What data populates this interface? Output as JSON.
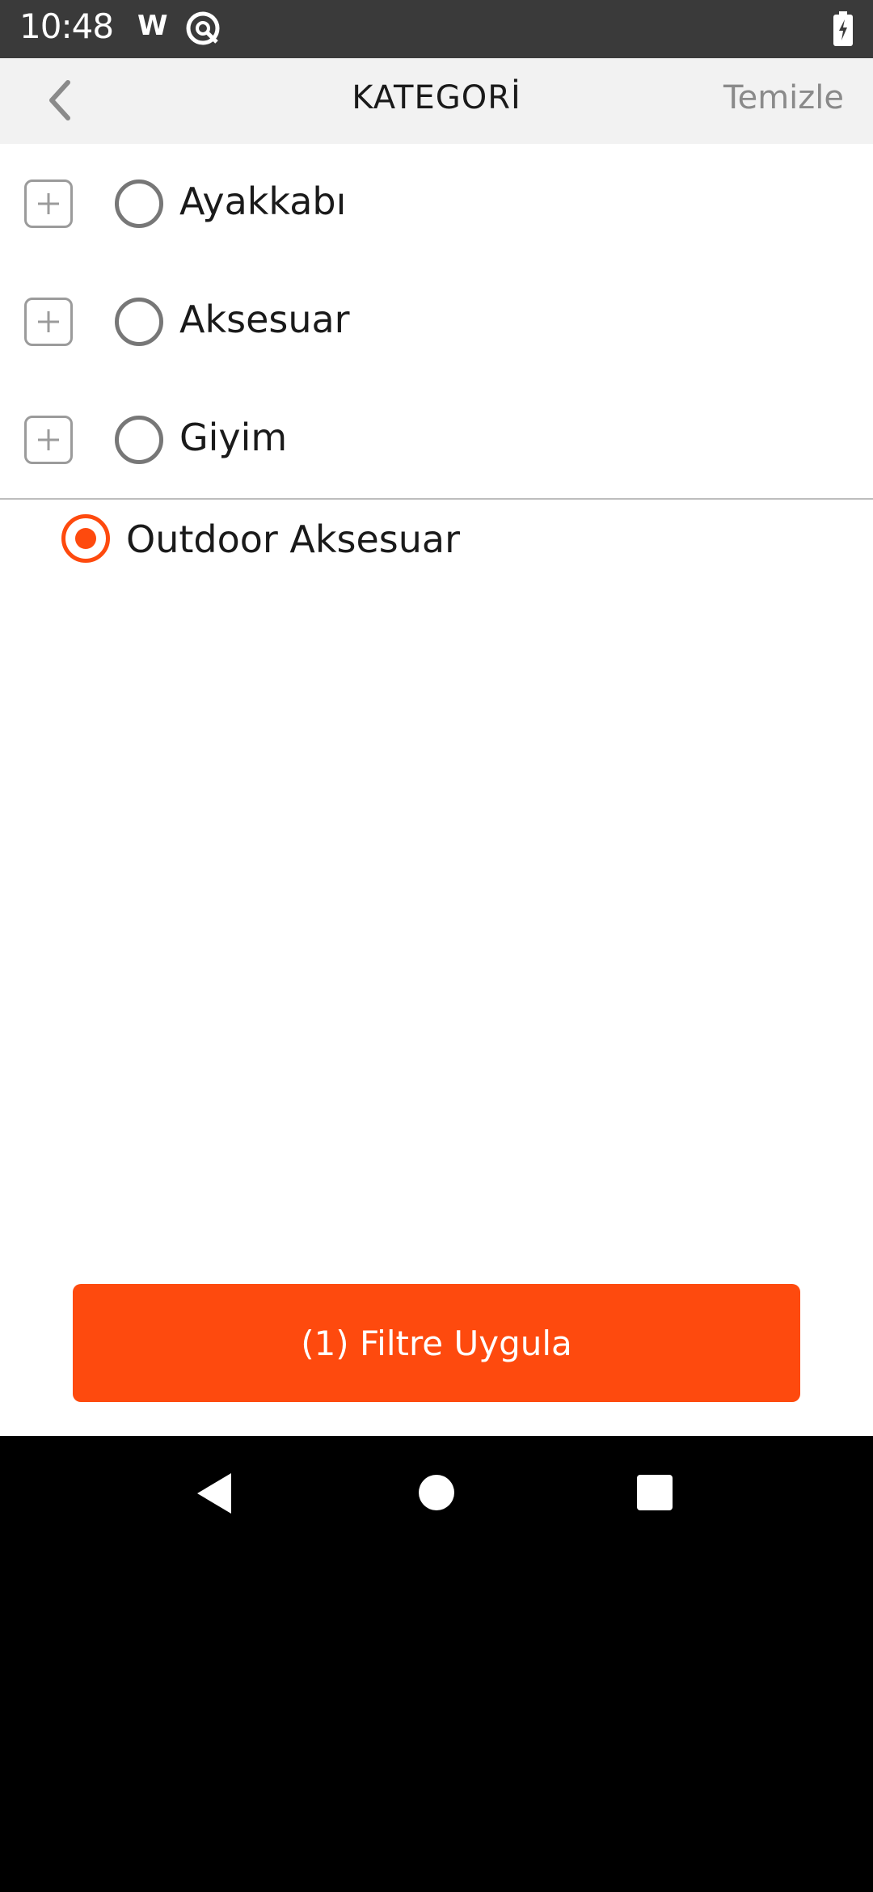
{
  "status_bar": {
    "time": "10:48",
    "w_label": "W"
  },
  "header": {
    "title": "KATEGORİ",
    "clear_label": "Temizle"
  },
  "categories": [
    {
      "label": "Ayakkabı",
      "selected": false
    },
    {
      "label": "Aksesuar",
      "selected": false
    },
    {
      "label": "Giyim",
      "selected": false
    }
  ],
  "subcategory": {
    "label": "Outdoor Aksesuar",
    "selected": true
  },
  "apply_button": {
    "label": "(1) Filtre Uygula"
  },
  "colors": {
    "accent": "#fe4a0e",
    "header_bg": "#f2f2f2",
    "status_bg": "#3a3a3a"
  }
}
